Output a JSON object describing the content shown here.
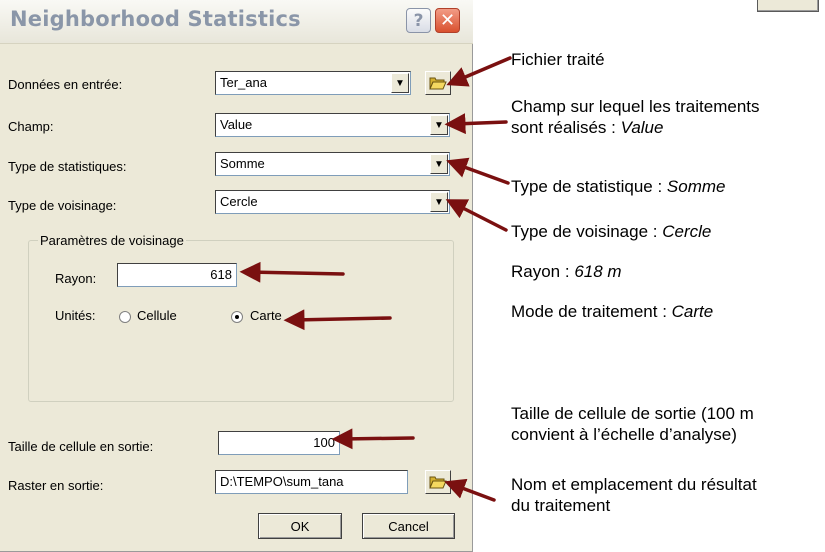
{
  "dialog": {
    "title": "Neighborhood Statistics",
    "help_glyph": "?",
    "close_glyph": "✕"
  },
  "fields": {
    "input_label": "Données en entrée:",
    "input_value": "Ter_ana",
    "field_label": "Champ:",
    "field_value": "Value",
    "stat_label": "Type de statistiques:",
    "stat_value": "Somme",
    "neigh_label": "Type de voisinage:",
    "neigh_value": "Cercle",
    "cellsize_label": "Taille de cellule en sortie:",
    "cellsize_value": "100",
    "output_label": "Raster en sortie:",
    "output_value": "D:\\TEMPO\\sum_tana"
  },
  "neighborhood_params": {
    "group_title": "Paramètres de voisinage",
    "radius_label": "Rayon:",
    "radius_value": "618",
    "units_label": "Unités:",
    "unit_cell": "Cellule",
    "unit_map": "Carte",
    "selected_unit": "Carte"
  },
  "buttons": {
    "ok": "OK",
    "cancel": "Cancel"
  },
  "annotations": {
    "a1": "Fichier traité",
    "a2_line1": "Champ sur lequel les traitements",
    "a2_line2_prefix": "sont réalisés : ",
    "a2_line2_italic": "Value",
    "a3_prefix": "Type de statistique : ",
    "a3_italic": "Somme",
    "a4_prefix": "Type de voisinage : ",
    "a4_italic": "Cercle",
    "a5_prefix": "Rayon : ",
    "a5_italic": "618 m",
    "a6_prefix": "Mode de traitement : ",
    "a6_italic": "Carte",
    "a7_line1": "Taille de cellule de sortie (100 m",
    "a7_line2": "convient à l’échelle d’analyse)",
    "a8_line1": "Nom et emplacement du résultat",
    "a8_line2": "du traitement"
  },
  "colors": {
    "arrow": "#7a1010",
    "dialog_bg": "#ece9d8",
    "title_text": "#8a96a8"
  },
  "icons": {
    "dropdown": "triangle-down",
    "folder": "open-folder",
    "help": "question-mark",
    "close": "x-mark"
  }
}
